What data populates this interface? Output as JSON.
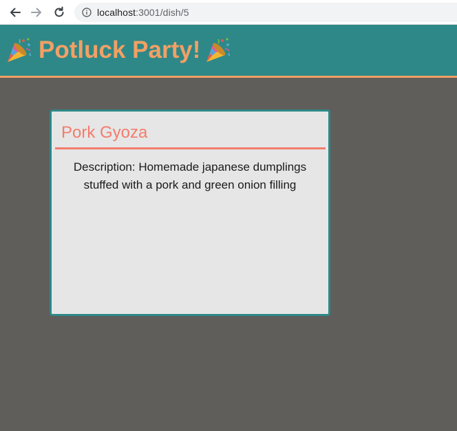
{
  "browser": {
    "url_host": "localhost",
    "url_path": ":3001/dish/5",
    "back_icon": "arrow-left-icon",
    "forward_icon": "arrow-right-icon",
    "reload_icon": "reload-icon",
    "info_icon": "info-icon"
  },
  "header": {
    "title": "Potluck Party!",
    "left_emoji": "party-popper-icon",
    "right_emoji": "party-popper-icon",
    "background_color": "#2e8888",
    "title_color": "#f2a065",
    "border_color": "#f2a065"
  },
  "dish": {
    "name": "Pork Gyoza",
    "description": "Description: Homemade japanese dumplings stuffed with a pork and green onion filling",
    "accent_color": "#f47c6c",
    "card_border_color": "#2e8888"
  },
  "page": {
    "background_color": "#5f5e5a"
  }
}
